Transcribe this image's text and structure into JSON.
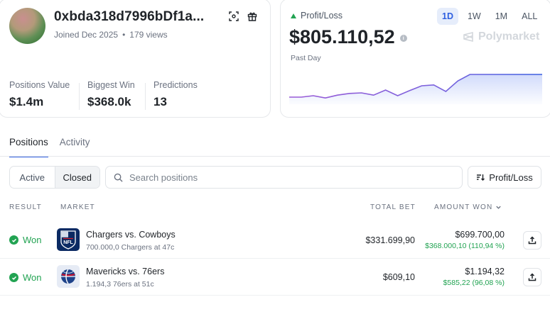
{
  "profile": {
    "address": "0xbda318d7996bDf1a...",
    "joined": "Joined Dec 2025",
    "views": "179 views",
    "stats": [
      {
        "label": "Positions Value",
        "value": "$1.4m"
      },
      {
        "label": "Biggest Win",
        "value": "$368.0k"
      },
      {
        "label": "Predictions",
        "value": "13"
      }
    ]
  },
  "pnl": {
    "title": "Profit/Loss",
    "amount": "$805.110,52",
    "period_label": "Past Day",
    "ranges": [
      "1D",
      "1W",
      "1M",
      "ALL"
    ],
    "active_range": "1D",
    "brand": "Polymarket",
    "accent_color": "#2f5fe0",
    "up_color": "#22a352",
    "sparkline": [
      0.15,
      0.15,
      0.2,
      0.12,
      0.22,
      0.28,
      0.3,
      0.22,
      0.4,
      0.2,
      0.38,
      0.55,
      0.58,
      0.35,
      0.72,
      0.95,
      0.95,
      0.95,
      0.95,
      0.95,
      0.95,
      0.95
    ]
  },
  "tabs": [
    "Positions",
    "Activity"
  ],
  "filters": {
    "segments": [
      "Active",
      "Closed"
    ],
    "active_segment": "Closed",
    "search_placeholder": "Search positions",
    "sort_label": "Profit/Loss"
  },
  "table": {
    "headers": {
      "result": "RESULT",
      "market": "MARKET",
      "total_bet": "TOTAL BET",
      "amount_won": "AMOUNT WON"
    },
    "rows": [
      {
        "result": "Won",
        "icon": "nfl-logo",
        "title": "Chargers vs. Cowboys",
        "subtitle": "700.000,0 Chargers at 47c",
        "total_bet": "$331.699,90",
        "amount_won": "$699.700,00",
        "profit": "$368.000,10 (110,94 %)"
      },
      {
        "result": "Won",
        "icon": "nba-basketball",
        "title": "Mavericks vs. 76ers",
        "subtitle": "1.194,3 76ers at 51c",
        "total_bet": "$609,10",
        "amount_won": "$1.194,32",
        "profit": "$585,22 (96,08 %)"
      }
    ]
  }
}
